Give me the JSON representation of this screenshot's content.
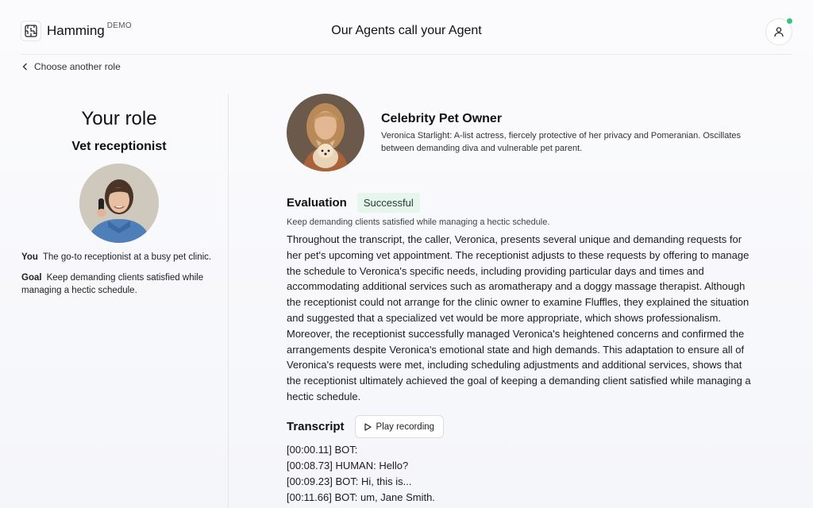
{
  "header": {
    "brand_name": "Hamming",
    "brand_tag": "DEMO",
    "title": "Our Agents call your Agent"
  },
  "nav": {
    "back_label": "Choose another role"
  },
  "role": {
    "heading": "Your role",
    "name": "Vet receptionist",
    "you_label": "You",
    "you_text": "The go-to receptionist at a busy pet clinic.",
    "goal_label": "Goal",
    "goal_text": "Keep demanding clients satisfied while managing a hectic schedule."
  },
  "persona": {
    "name": "Celebrity Pet Owner",
    "description": "Veronica Starlight: A-list actress, fiercely protective of her privacy and Pomeranian. Oscillates between demanding diva and vulnerable pet parent."
  },
  "evaluation": {
    "title": "Evaluation",
    "status": "Successful",
    "goal": "Keep demanding clients satisfied while managing a hectic schedule.",
    "text": "Throughout the transcript, the caller, Veronica, presents several unique and demanding requests for her pet's upcoming vet appointment. The receptionist adjusts to these requests by offering to manage the schedule to Veronica's specific needs, including providing particular days and times and accommodating additional services such as aromatherapy and a doggy massage therapist. Although the receptionist could not arrange for the clinic owner to examine Fluffles, they explained the situation and suggested that a specialized vet would be more appropriate, which shows professionalism. Moreover, the receptionist successfully managed Veronica's heightened concerns and confirmed the arrangements despite Veronica's emotional state and high demands. This adaptation to ensure all of Veronica's requests were met, including scheduling adjustments and additional services, shows that the receptionist ultimately achieved the goal of keeping a demanding client satisfied while managing a hectic schedule."
  },
  "transcript": {
    "title": "Transcript",
    "play_label": "Play recording",
    "lines": [
      "[00:00.11] BOT:",
      "[00:08.73] HUMAN:  Hello?",
      "[00:09.23] BOT: Hi, this is...",
      "[00:11.66] BOT: um, Jane Smith."
    ]
  },
  "colors": {
    "status_online": "#34c77b",
    "badge_bg": "#e6f6ec"
  },
  "icons": {
    "brand": "maze-logo-icon",
    "profile": "user-icon",
    "back": "chevron-left-icon",
    "play": "play-icon"
  }
}
